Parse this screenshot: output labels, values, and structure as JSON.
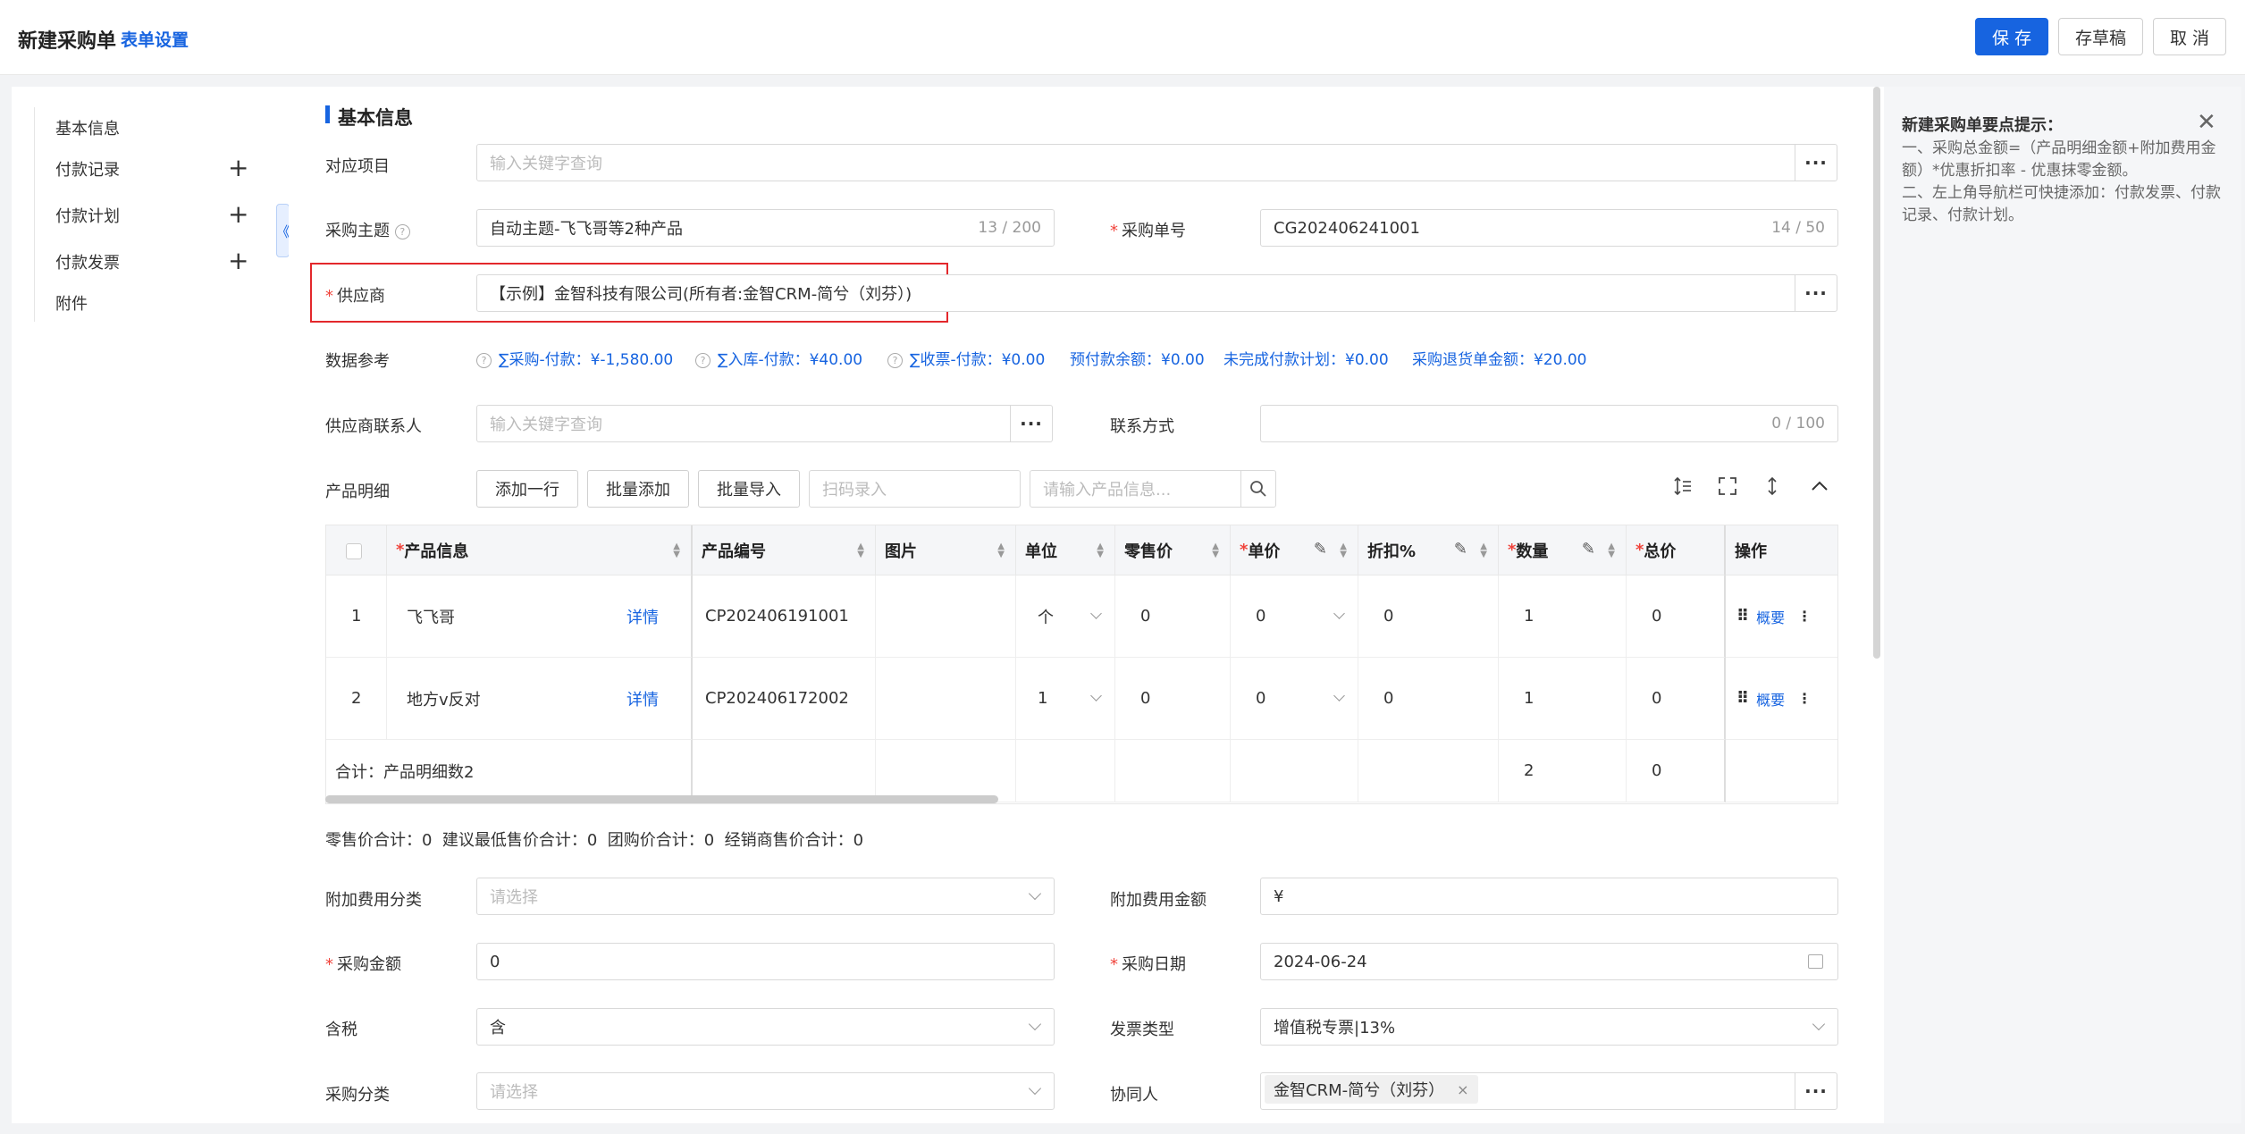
{
  "header": {
    "title": "新建采购单",
    "settings_link": "表单设置",
    "save": "保 存",
    "draft": "存草稿",
    "cancel": "取 消"
  },
  "nav": {
    "items": [
      "基本信息",
      "付款记录",
      "付款计划",
      "付款发票",
      "附件"
    ],
    "plus": "+",
    "collapse": "《"
  },
  "section": {
    "title": "基本信息"
  },
  "form": {
    "project": {
      "label": "对应项目",
      "placeholder": "输入关键字查询"
    },
    "subject": {
      "label": "采购主题",
      "value": "自动主题-飞飞哥等2种产品",
      "counter": "13 / 200"
    },
    "order_no": {
      "label": "采购单号",
      "value": "CG202406241001",
      "counter": "14 / 50"
    },
    "supplier": {
      "label": "供应商",
      "value": "【示例】金智科技有限公司(所有者:金智CRM-简兮（刘芬）)"
    },
    "data_ref": {
      "label": "数据参考",
      "items": [
        "∑采购-付款：¥-1,580.00",
        "∑入库-付款：¥40.00",
        "∑收票-付款：¥0.00",
        "预付款余额：¥0.00",
        "未完成付款计划：¥0.00",
        "采购退货单金额：¥20.00"
      ]
    },
    "contact": {
      "label": "供应商联系人",
      "placeholder": "输入关键字查询"
    },
    "contact_way": {
      "label": "联系方式",
      "counter": "0 / 100"
    },
    "products_label": "产品明细",
    "extra_type": {
      "label": "附加费用分类",
      "placeholder": "请选择"
    },
    "extra_amount": {
      "label": "附加费用金额",
      "value": "¥"
    },
    "amount": {
      "label": "采购金额",
      "value": "0"
    },
    "date": {
      "label": "采购日期",
      "value": "2024-06-24"
    },
    "tax": {
      "label": "含税",
      "value": "含"
    },
    "invoice_type": {
      "label": "发票类型",
      "value": "增值税专票|13%"
    },
    "category": {
      "label": "采购分类",
      "placeholder": "请选择"
    },
    "collaborator": {
      "label": "协同人",
      "tag": "金智CRM-简兮（刘芬）",
      "tag_x": "×"
    }
  },
  "toolbar": {
    "add_row": "添加一行",
    "batch_add": "批量添加",
    "batch_import": "批量导入",
    "scan_placeholder": "扫码录入",
    "search_placeholder": "请输入产品信息...",
    "dots": "···"
  },
  "table": {
    "headers": {
      "product": "产品信息",
      "code": "产品编号",
      "image": "图片",
      "unit": "单位",
      "retail": "零售价",
      "price": "单价",
      "discount": "折扣%",
      "qty": "数量",
      "total": "总价",
      "ops": "操作"
    },
    "rows": [
      {
        "idx": "1",
        "name": "飞飞哥",
        "detail": "详情",
        "code": "CP202406191001",
        "unit": "个",
        "retail": "0",
        "price": "0",
        "discount": "0",
        "qty": "1",
        "total": "0",
        "summary": "概要"
      },
      {
        "idx": "2",
        "name": "地方v反对",
        "detail": "详情",
        "code": "CP202406172002",
        "unit": "1",
        "retail": "0",
        "price": "0",
        "discount": "0",
        "qty": "1",
        "total": "0",
        "summary": "概要"
      }
    ],
    "footer": {
      "label": "合计：产品明细数2",
      "qty": "2",
      "total": "0"
    }
  },
  "summary_line": "零售价合计：0  建议最低售价合计：0  团购价合计：0  经销商售价合计：0",
  "tips": {
    "title": "新建采购单要点提示：",
    "close": "✕",
    "lines": [
      "一、采购总金额=（产品明细金额+附加费用金额）*优惠折扣率 - 优惠抹零金额。",
      "二、左上角导航栏可快捷添加：付款发票、付款记录、付款计划。"
    ]
  },
  "colors": {
    "accent": "#1764e0",
    "required": "#f0443c",
    "highlight": "#e3282c"
  }
}
